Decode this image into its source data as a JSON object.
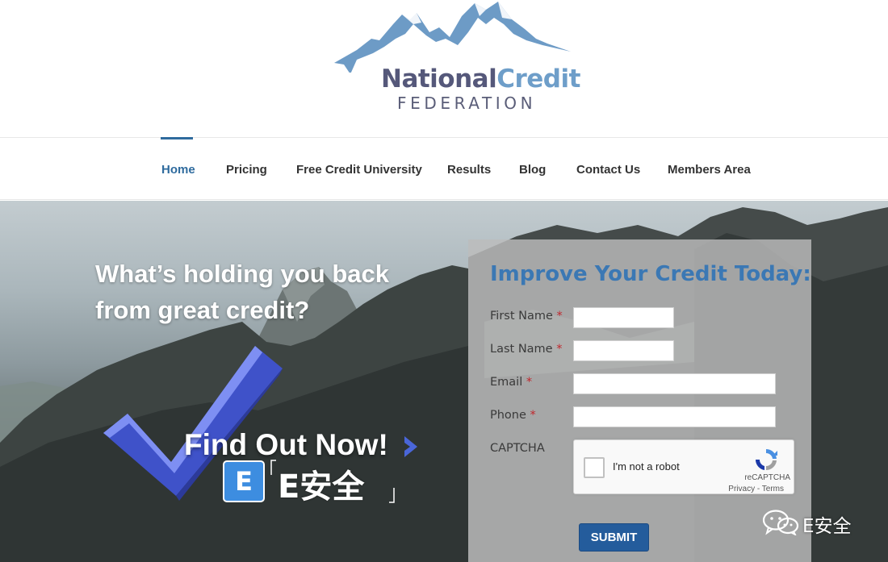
{
  "logo": {
    "name_part1": "National",
    "name_part2": "Credit",
    "subtitle": "FEDERATION",
    "icon": "mountain-logo-icon"
  },
  "nav": {
    "items": [
      {
        "label": "Home",
        "active": true
      },
      {
        "label": "Pricing",
        "active": false
      },
      {
        "label": "Free Credit University",
        "active": false
      },
      {
        "label": "Results",
        "active": false
      },
      {
        "label": "Blog",
        "active": false
      },
      {
        "label": "Contact Us",
        "active": false
      },
      {
        "label": "Members Area",
        "active": false
      }
    ]
  },
  "hero": {
    "headline": "What’s holding you back from great credit?",
    "cta_label": "Find Out Now!",
    "cta_icon": "chevron-right-icon",
    "watermark_text": "E安全",
    "watermark_letter": "E"
  },
  "form": {
    "title": "Improve Your Credit Today:",
    "fields": [
      {
        "label": "First Name",
        "required_mark": "*",
        "value": ""
      },
      {
        "label": "Last Name",
        "required_mark": "*",
        "value": ""
      },
      {
        "label": "Email",
        "required_mark": "*",
        "value": ""
      },
      {
        "label": "Phone",
        "required_mark": "*",
        "value": ""
      }
    ],
    "captcha": {
      "label": "CAPTCHA",
      "checkbox_text": "I'm not a robot",
      "brand": "reCAPTCHA",
      "links": "Privacy - Terms",
      "checked": false
    },
    "submit_label": "SUBMIT"
  },
  "wechat": {
    "text": "E安全",
    "icon": "wechat-icon"
  },
  "colors": {
    "accent": "#2f6b9e",
    "form_title": "#3b78b4",
    "submit": "#245c9c",
    "required": "#c1272d"
  }
}
